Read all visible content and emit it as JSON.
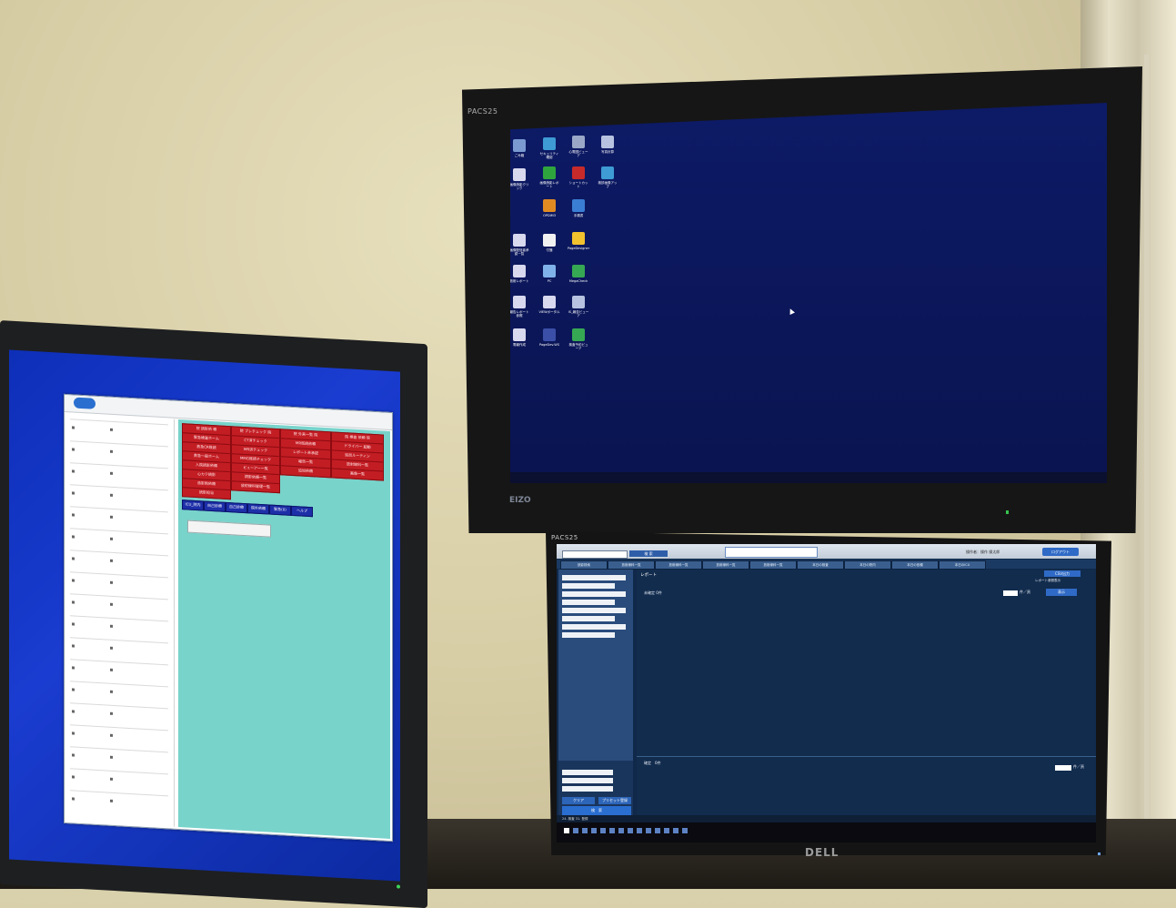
{
  "top_monitor": {
    "label": "PACS25",
    "brand": "EIZO",
    "desktop_icons": [
      {
        "label": "ごみ箱",
        "icon": "recycle-bin-icon",
        "color": "#7a9ad1"
      },
      {
        "label": "セキュリティ確認",
        "icon": "globe-icon",
        "color": "#3e9bd4"
      },
      {
        "label": "心電図ビューア",
        "icon": "document-icon",
        "color": "#9aa7c7"
      },
      {
        "label": "写真計算",
        "icon": "document-icon",
        "color": "#b7c2e0"
      },
      {
        "label": "画像読影クリック",
        "icon": "app-icon",
        "color": "#d8d8ef"
      },
      {
        "label": "画像読影レポート",
        "icon": "chart-icon",
        "color": "#2fa53e"
      },
      {
        "label": "ショートカット",
        "icon": "alert-icon",
        "color": "#c72a2a"
      },
      {
        "label": "検診画像アップ",
        "icon": "globe-icon",
        "color": "#3e9bd4"
      },
      {
        "label": "OPDIM3",
        "icon": "app-icon",
        "color": "#e08b22"
      },
      {
        "label": "手順書",
        "icon": "help-icon",
        "color": "#3a7dd4"
      },
      {
        "label": "画像配信者承認一覧",
        "icon": "document-icon",
        "color": "#d8d8ef"
      },
      {
        "label": "付箋",
        "icon": "note-icon",
        "color": "#f1f1f1"
      },
      {
        "label": "PageDesigner",
        "icon": "star-icon",
        "color": "#f2c12e"
      },
      {
        "label": "放射レポート",
        "icon": "document-icon",
        "color": "#d8d8ef"
      },
      {
        "label": "PC",
        "icon": "computer-icon",
        "color": "#7fb2e8"
      },
      {
        "label": "MegaCheck",
        "icon": "tool-icon",
        "color": "#36a853"
      },
      {
        "label": "報告レポート参照",
        "icon": "document-icon",
        "color": "#d8d8ef"
      },
      {
        "label": "VIEWポータル",
        "icon": "document-icon",
        "color": "#d8d8ef"
      },
      {
        "label": "IS_報告ビューア",
        "icon": "document-icon",
        "color": "#b7c2e0"
      },
      {
        "label": "電報作成",
        "icon": "document-icon",
        "color": "#d8d8ef"
      },
      {
        "label": "PageDev.WS",
        "icon": "app-icon",
        "color": "#3b4fa8"
      },
      {
        "label": "検査予約ビューア",
        "icon": "arrow-icon",
        "color": "#36a853"
      }
    ]
  },
  "left_monitor": {
    "red_buttons": [
      "院 読影依 頼",
      "院 ブレチェック 院",
      "院 外来一覧 院",
      "院 検査 依頼 院",
      "緊急検査ホーム",
      "CT済チェック",
      "MR既読依頼",
      "ドライバー 起動",
      "救急CR既読",
      "MR済チェック",
      "レポート未承認",
      "追加ルーティン",
      "救急一般ホーム",
      "MMG既読チェック",
      "報告一覧",
      "放射線科一覧",
      "入院読影依頼",
      "ビューアー一覧",
      "追加依頼",
      "画像一覧",
      "心カテ読影",
      "読影依頼一覧",
      "CR読影一覧",
      "IVR読影",
      "造影剤依頼",
      "放射線科管理一覧",
      "読影担当"
    ],
    "blue_buttons": [
      "ICU_院内",
      "自己診療",
      "自己診療",
      "院外依頼",
      "緊急(0)",
      "ヘルプ"
    ]
  },
  "bottom_monitor": {
    "label": "PACS25",
    "brand": "DELL",
    "search_button": "検 索",
    "user_info": "操作者：操作 操太郎",
    "logout_button": "ログアウト",
    "tabs": [
      "読影検索",
      "放射線科一覧",
      "放射線科一覧",
      "放射線科一覧",
      "放射線科一覧",
      "本日の検査",
      "本日の院内",
      "本日の依頼",
      "本日のICU"
    ],
    "report_title": "レポート",
    "csv_button": "CSV出力",
    "report_check": "レポート参照表示",
    "unread_label": "未確定 0件",
    "pager_text": "件／頁",
    "show_button": "表示",
    "done_label": "確定　0件",
    "pager2_text": "件／頁",
    "clear_button": "クリア",
    "preset_button": "プリセット登録",
    "search_big_button": "検　索",
    "status_text": "24. 検査 31. 登録"
  }
}
